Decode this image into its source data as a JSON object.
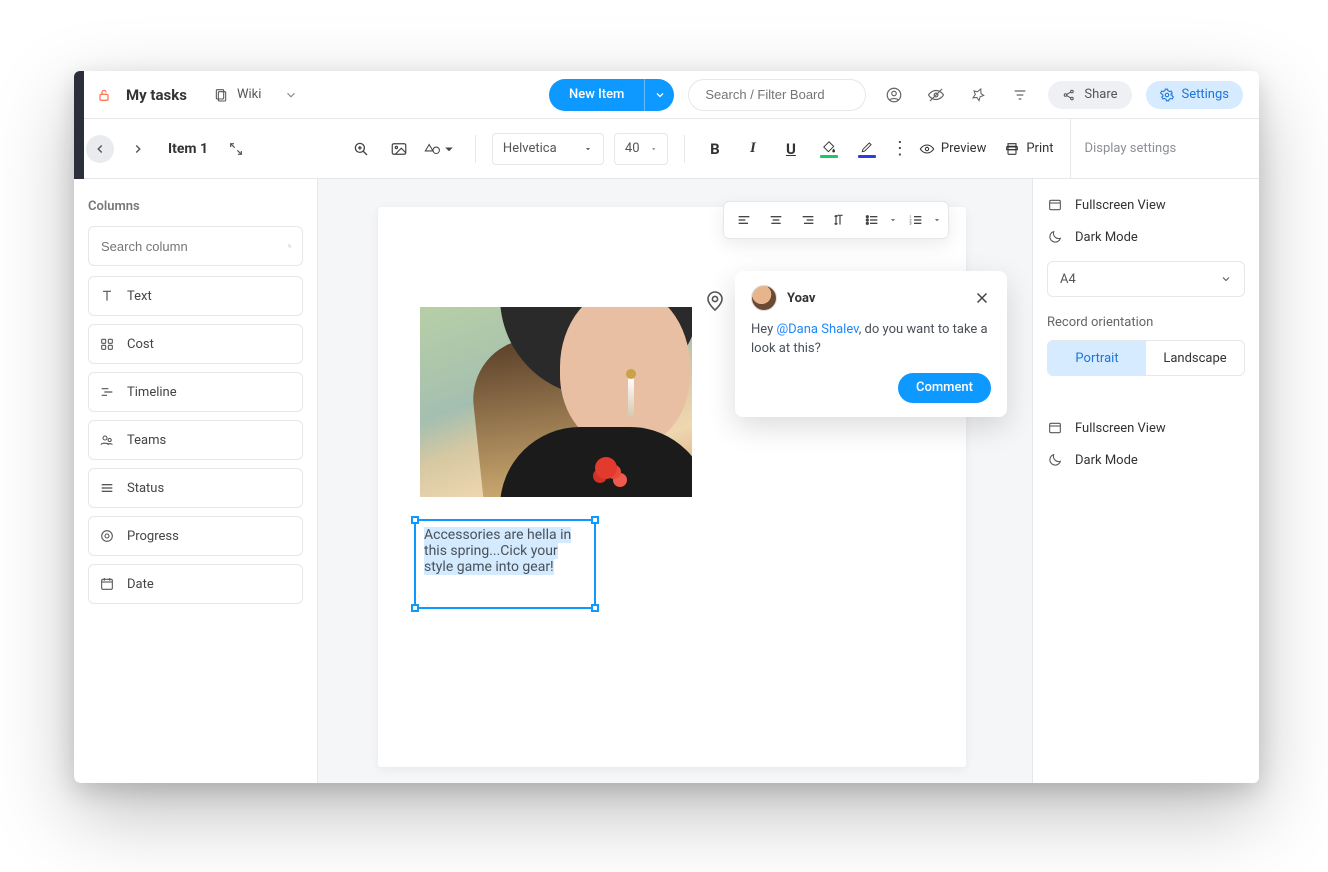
{
  "topbar": {
    "board_title": "My tasks",
    "tab_label": "Wiki",
    "new_item_label": "New Item",
    "search_placeholder": "Search / Filter Board",
    "share_label": "Share",
    "settings_label": "Settings"
  },
  "toolbar": {
    "item_title": "Item 1",
    "font": "Helvetica",
    "font_size": "40",
    "preview_label": "Preview",
    "print_label": "Print"
  },
  "columns": {
    "title": "Columns",
    "search_placeholder": "Search column",
    "items": [
      {
        "icon": "text",
        "label": "Text"
      },
      {
        "icon": "cost",
        "label": "Cost"
      },
      {
        "icon": "timeline",
        "label": "Timeline"
      },
      {
        "icon": "teams",
        "label": "Teams"
      },
      {
        "icon": "status",
        "label": "Status"
      },
      {
        "icon": "progress",
        "label": "Progress"
      },
      {
        "icon": "date",
        "label": "Date"
      }
    ]
  },
  "canvas": {
    "text_block": "Accessories are hella in this spring...Cick your style game into gear!"
  },
  "comment": {
    "author": "Yoav",
    "mention": "@Dana Shalev",
    "before": "Hey ",
    "after": ", do you want to take a look at this?",
    "button": "Comment"
  },
  "right_panel": {
    "header": "Display settings",
    "fullscreen": "Fullscreen View",
    "darkmode": "Dark Mode",
    "paper_size": "A4",
    "orientation_label": "Record orientation",
    "portrait": "Portrait",
    "landscape": "Landscape",
    "fullscreen2": "Fullscreen View",
    "darkmode2": "Dark Mode"
  }
}
